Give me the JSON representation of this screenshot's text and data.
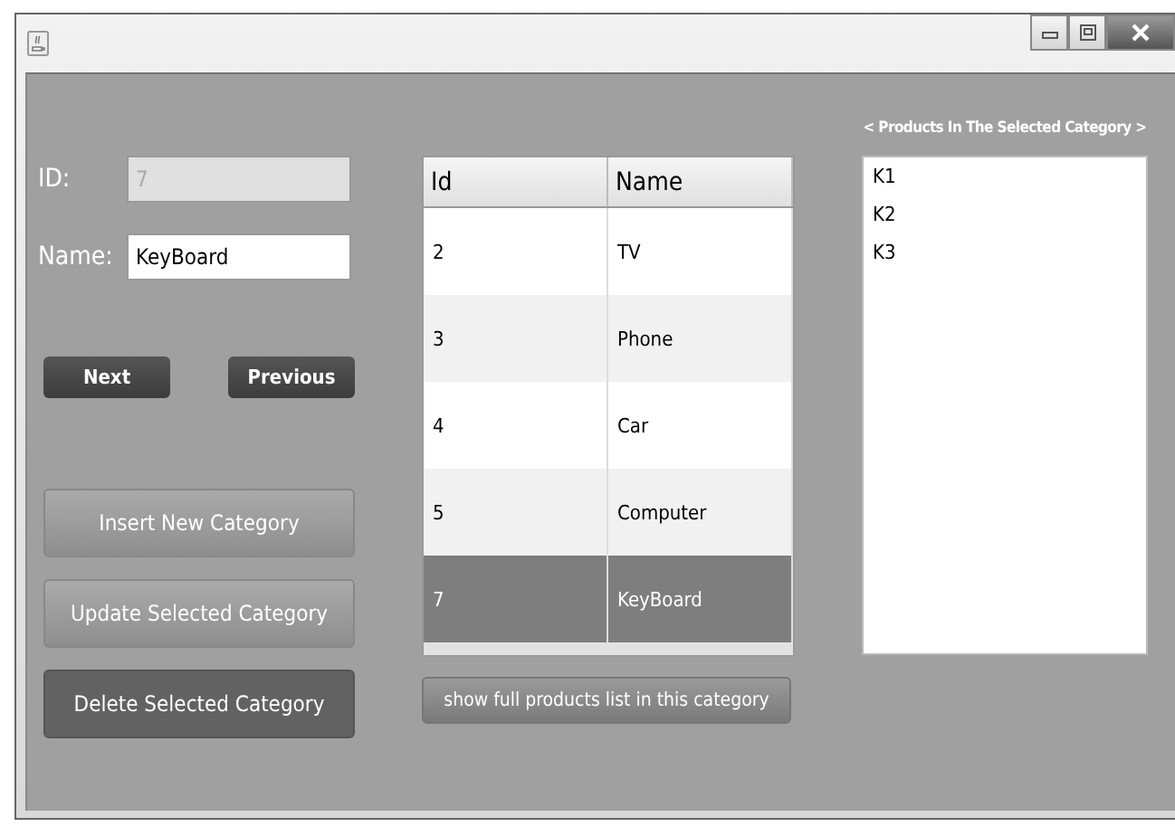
{
  "form": {
    "id_label": "ID:",
    "id_value": "7",
    "id_disabled": true,
    "name_label": "Name:",
    "name_value": "KeyBoard"
  },
  "nav_buttons": [
    "Next",
    "Previous"
  ],
  "action_buttons": [
    {
      "label": "Insert New Category",
      "highlighted": false
    },
    {
      "label": "Update Selected Category",
      "highlighted": false
    },
    {
      "label": "Delete Selected Category",
      "highlighted": true
    }
  ],
  "table": {
    "columns": [
      "Id",
      "Name"
    ],
    "rows": [
      {
        "cells": [
          "2",
          "TV"
        ],
        "selected": false
      },
      {
        "cells": [
          "3",
          "Phone"
        ],
        "selected": false
      },
      {
        "cells": [
          "4",
          "Car"
        ],
        "selected": false
      },
      {
        "cells": [
          "5",
          "Computer"
        ],
        "selected": false
      },
      {
        "cells": [
          "7",
          "KeyBoard"
        ],
        "selected": true
      }
    ]
  },
  "show_products_button": "show full  products list in this category",
  "products": {
    "title": "< Products In The Selected Category >",
    "items": [
      "K1",
      "K2",
      "K3"
    ]
  }
}
